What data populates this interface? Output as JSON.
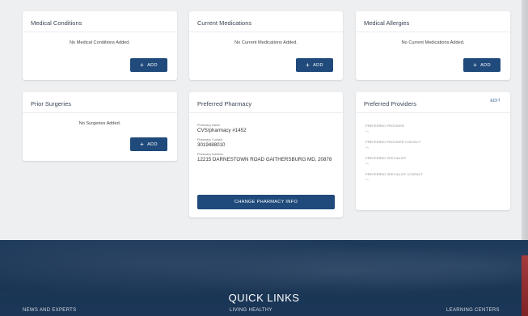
{
  "colors": {
    "primary": "#1f4a7b",
    "background": "#eeeff1",
    "footer": "#1e3a5c",
    "accent": "#a43a3c"
  },
  "cards": {
    "medical_conditions": {
      "title": "Medical Conditions",
      "empty": "No Medical Conditions Added.",
      "button": "ADD"
    },
    "current_medications": {
      "title": "Current Medications",
      "empty": "No Current Medications Added.",
      "button": "ADD"
    },
    "medical_allergies": {
      "title": "Medical Allergies",
      "empty": "No Current Medications Added.",
      "button": "ADD"
    },
    "prior_surgeries": {
      "title": "Prior Surgeries",
      "empty": "No Surgeries Added.",
      "button": "ADD"
    }
  },
  "pharmacy": {
    "title": "Preferred Pharmacy",
    "name_label": "Pharmacy Name",
    "name": "CVS/pharmacy #1452",
    "contact_label": "Pharmacy Contact",
    "contact": "3019488010",
    "address_label": "Pharmacy Address",
    "address": "12215 DARNESTOWN ROAD GAITHERSBURG MD, 20878",
    "button": "CHANGE PHARMACY INFO"
  },
  "providers": {
    "title": "Preferred Providers",
    "edit": "EDIT",
    "fields": [
      {
        "label": "PREFERRED PROVIDER",
        "value": "--"
      },
      {
        "label": "PREFERRED PROVIDER CONTACT",
        "value": "--"
      },
      {
        "label": "PREFERRED SPECIALIST",
        "value": "--"
      },
      {
        "label": "PREFERRED SPECIALIST CONTACT",
        "value": "--"
      }
    ]
  },
  "footer": {
    "title": "QUICK LINKS",
    "links": [
      "NEWS AND EXPERTS",
      "LIVING HEALTHY",
      "LEARNING CENTERS"
    ]
  },
  "icons": {
    "add": "plus-icon"
  }
}
